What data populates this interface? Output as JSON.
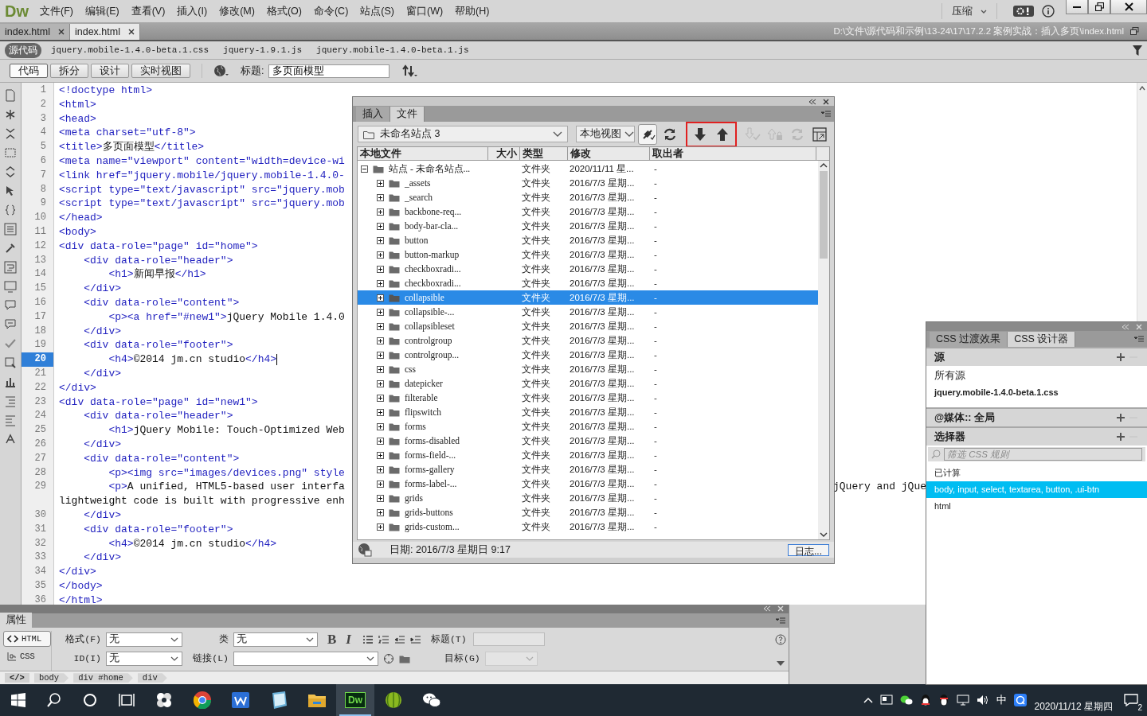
{
  "app": {
    "logo": "Dw",
    "menus": [
      "文件(F)",
      "编辑(E)",
      "查看(V)",
      "插入(I)",
      "修改(M)",
      "格式(O)",
      "命令(C)",
      "站点(S)",
      "窗口(W)",
      "帮助(H)"
    ],
    "workspace": "压缩"
  },
  "doc_tabs": [
    {
      "label": "index.html",
      "selected": false
    },
    {
      "label": "index.html",
      "selected": true
    }
  ],
  "file_path": "D:\\文件\\源代码和示例\\13-24\\17\\17.2.2  案例实战：插入多页\\index.html",
  "related_files": [
    {
      "label": "源代码",
      "selected": true
    },
    {
      "label": "jquery.mobile-1.4.0-beta.1.css",
      "selected": false
    },
    {
      "label": "jquery-1.9.1.js",
      "selected": false
    },
    {
      "label": "jquery.mobile-1.4.0-beta.1.js",
      "selected": false
    }
  ],
  "doc_toolbar": {
    "views": [
      {
        "label": "代码",
        "selected": true
      },
      {
        "label": "拆分",
        "selected": false
      },
      {
        "label": "设计",
        "selected": false
      },
      {
        "label": "实时视图",
        "selected": false
      }
    ],
    "title_label": "标题:",
    "title_value": "多页面模型"
  },
  "code": {
    "lines": [
      {
        "number": "1",
        "parts": [
          "<!doctype html>"
        ],
        "current": false
      },
      {
        "number": "2",
        "parts": [
          "<html>"
        ],
        "current": false
      },
      {
        "number": "3",
        "parts": [
          "<head>"
        ],
        "current": false
      },
      {
        "number": "4",
        "parts": [
          "<meta charset=\"utf-8\">"
        ],
        "current": false
      },
      {
        "number": "5",
        "parts": [
          "<title>",
          "多页面模型",
          "</title>"
        ],
        "current": false
      },
      {
        "number": "6",
        "parts": [
          "<meta name=\"viewport\" content=\"width=device-wi"
        ],
        "current": false
      },
      {
        "number": "7",
        "parts": [
          "<link href=\"jquery.mobile/jquery.mobile-1.4.0-"
        ],
        "current": false
      },
      {
        "number": "8",
        "parts": [
          "<script type=\"text/javascript\" src=\"jquery.mob"
        ],
        "current": false
      },
      {
        "number": "9",
        "parts": [
          "<script type=\"text/javascript\" src=\"jquery.mob"
        ],
        "current": false
      },
      {
        "number": "10",
        "parts": [
          "</head>"
        ],
        "current": false
      },
      {
        "number": "11",
        "parts": [
          "<body>"
        ],
        "current": false
      },
      {
        "number": "12",
        "parts": [
          "<div data-role=\"page\" id=\"home\">"
        ],
        "current": false
      },
      {
        "number": "13",
        "parts": [
          "    <div data-role=\"header\">"
        ],
        "current": false
      },
      {
        "number": "14",
        "parts": [
          "        <h1>",
          "新闻早报",
          "</h1>"
        ],
        "current": false
      },
      {
        "number": "15",
        "parts": [
          "    </div>"
        ],
        "current": false
      },
      {
        "number": "16",
        "parts": [
          "    <div data-role=\"content\">"
        ],
        "current": false
      },
      {
        "number": "17",
        "parts": [
          "        <p><a href=\"#new1\">",
          "jQuery Mobile 1.4.0"
        ],
        "current": false
      },
      {
        "number": "18",
        "parts": [
          "    </div>"
        ],
        "current": false
      },
      {
        "number": "19",
        "parts": [
          "    <div data-role=\"footer\">"
        ],
        "current": false
      },
      {
        "number": "20",
        "parts": [
          "        <h4>",
          "©2014 jm.cn studio",
          "</h4>"
        ],
        "current": true
      },
      {
        "number": "21",
        "parts": [
          "    </div>"
        ],
        "current": false
      },
      {
        "number": "22",
        "parts": [
          "</div>"
        ],
        "current": false
      },
      {
        "number": "23",
        "parts": [
          "<div data-role=\"page\" id=\"new1\">"
        ],
        "current": false
      },
      {
        "number": "24",
        "parts": [
          "    <div data-role=\"header\">"
        ],
        "current": false
      },
      {
        "number": "25",
        "parts": [
          "        <h1>",
          "jQuery Mobile: Touch-Optimized Web"
        ],
        "current": false
      },
      {
        "number": "26",
        "parts": [
          "    </div>"
        ],
        "current": false
      },
      {
        "number": "27",
        "parts": [
          "    <div data-role=\"content\">"
        ],
        "current": false
      },
      {
        "number": "28",
        "parts": [
          "        <p><img src=\"images/devices.png\" style"
        ],
        "current": false
      },
      {
        "number": "29",
        "parts": [
          "        <p>",
          "A unified, HTML5-based user interfa"
        ],
        "tail": "jQuery and jQue",
        "wrap": "lightweight code is built with progressive enh",
        "current": false
      },
      {
        "number": "30",
        "parts": [
          "    </div>"
        ],
        "current": false
      },
      {
        "number": "31",
        "parts": [
          "    <div data-role=\"footer\">"
        ],
        "current": false
      },
      {
        "number": "32",
        "parts": [
          "        <h4>",
          "©2014 jm.cn studio",
          "</h4>"
        ],
        "current": false
      },
      {
        "number": "33",
        "parts": [
          "    </div>"
        ],
        "current": false
      },
      {
        "number": "34",
        "parts": [
          "</div>"
        ],
        "current": false
      },
      {
        "number": "35",
        "parts": [
          "</body>"
        ],
        "current": false
      },
      {
        "number": "36",
        "parts": [
          "</html>"
        ],
        "current": false
      }
    ]
  },
  "files_panel": {
    "tabs": [
      {
        "label": "插入",
        "selected": false
      },
      {
        "label": "文件",
        "selected": true
      }
    ],
    "site": "未命名站点 3",
    "view": "本地视图",
    "tools": [
      {
        "kind": "connect",
        "disabled": false,
        "highlighted": false
      },
      {
        "kind": "refresh",
        "disabled": false,
        "highlighted": false
      },
      {
        "kind": "get",
        "disabled": false,
        "highlighted": true
      },
      {
        "kind": "put",
        "disabled": false,
        "highlighted": true
      },
      {
        "kind": "checkin",
        "disabled": true,
        "highlighted": false
      },
      {
        "kind": "checkout",
        "disabled": true,
        "highlighted": false
      },
      {
        "kind": "sync",
        "disabled": true,
        "highlighted": false
      },
      {
        "kind": "expand",
        "disabled": false,
        "highlighted": false
      }
    ],
    "columns": [
      "本地文件",
      "大小",
      "类型",
      "修改",
      "取出者"
    ],
    "tree": [
      {
        "name": "站点 - 未命名站点...",
        "type": "文件夹",
        "modified": "2020/11/11 星...",
        "checked_out_by": "-",
        "expanded": true,
        "selected": false,
        "children": [
          {
            "name": "_assets",
            "type": "文件夹",
            "modified": "2016/7/3 星期...",
            "checked_out_by": "-",
            "expanded": false,
            "selected": false
          },
          {
            "name": "_search",
            "type": "文件夹",
            "modified": "2016/7/3 星期...",
            "checked_out_by": "-",
            "expanded": false,
            "selected": false
          },
          {
            "name": "backbone-req...",
            "type": "文件夹",
            "modified": "2016/7/3 星期...",
            "checked_out_by": "-",
            "expanded": false,
            "selected": false
          },
          {
            "name": "body-bar-cla...",
            "type": "文件夹",
            "modified": "2016/7/3 星期...",
            "checked_out_by": "-",
            "expanded": false,
            "selected": false
          },
          {
            "name": "button",
            "type": "文件夹",
            "modified": "2016/7/3 星期...",
            "checked_out_by": "-",
            "expanded": false,
            "selected": false
          },
          {
            "name": "button-markup",
            "type": "文件夹",
            "modified": "2016/7/3 星期...",
            "checked_out_by": "-",
            "expanded": false,
            "selected": false
          },
          {
            "name": "checkboxradi...",
            "type": "文件夹",
            "modified": "2016/7/3 星期...",
            "checked_out_by": "-",
            "expanded": false,
            "selected": false
          },
          {
            "name": "checkboxradi...",
            "type": "文件夹",
            "modified": "2016/7/3 星期...",
            "checked_out_by": "-",
            "expanded": false,
            "selected": false
          },
          {
            "name": "collapsible",
            "type": "文件夹",
            "modified": "2016/7/3 星期...",
            "checked_out_by": "-",
            "expanded": false,
            "selected": true
          },
          {
            "name": "collapsible-...",
            "type": "文件夹",
            "modified": "2016/7/3 星期...",
            "checked_out_by": "-",
            "expanded": false,
            "selected": false
          },
          {
            "name": "collapsibleset",
            "type": "文件夹",
            "modified": "2016/7/3 星期...",
            "checked_out_by": "-",
            "expanded": false,
            "selected": false
          },
          {
            "name": "controlgroup",
            "type": "文件夹",
            "modified": "2016/7/3 星期...",
            "checked_out_by": "-",
            "expanded": false,
            "selected": false
          },
          {
            "name": "controlgroup...",
            "type": "文件夹",
            "modified": "2016/7/3 星期...",
            "checked_out_by": "-",
            "expanded": false,
            "selected": false
          },
          {
            "name": "css",
            "type": "文件夹",
            "modified": "2016/7/3 星期...",
            "checked_out_by": "-",
            "expanded": false,
            "selected": false
          },
          {
            "name": "datepicker",
            "type": "文件夹",
            "modified": "2016/7/3 星期...",
            "checked_out_by": "-",
            "expanded": false,
            "selected": false
          },
          {
            "name": "filterable",
            "type": "文件夹",
            "modified": "2016/7/3 星期...",
            "checked_out_by": "-",
            "expanded": false,
            "selected": false
          },
          {
            "name": "flipswitch",
            "type": "文件夹",
            "modified": "2016/7/3 星期...",
            "checked_out_by": "-",
            "expanded": false,
            "selected": false
          },
          {
            "name": "forms",
            "type": "文件夹",
            "modified": "2016/7/3 星期...",
            "checked_out_by": "-",
            "expanded": false,
            "selected": false
          },
          {
            "name": "forms-disabled",
            "type": "文件夹",
            "modified": "2016/7/3 星期...",
            "checked_out_by": "-",
            "expanded": false,
            "selected": false
          },
          {
            "name": "forms-field-...",
            "type": "文件夹",
            "modified": "2016/7/3 星期...",
            "checked_out_by": "-",
            "expanded": false,
            "selected": false
          },
          {
            "name": "forms-gallery",
            "type": "文件夹",
            "modified": "2016/7/3 星期...",
            "checked_out_by": "-",
            "expanded": false,
            "selected": false
          },
          {
            "name": "forms-label-...",
            "type": "文件夹",
            "modified": "2016/7/3 星期...",
            "checked_out_by": "-",
            "expanded": false,
            "selected": false
          },
          {
            "name": "grids",
            "type": "文件夹",
            "modified": "2016/7/3 星期...",
            "checked_out_by": "-",
            "expanded": false,
            "selected": false
          },
          {
            "name": "grids-buttons",
            "type": "文件夹",
            "modified": "2016/7/3 星期...",
            "checked_out_by": "-",
            "expanded": false,
            "selected": false
          },
          {
            "name": "grids-custom...",
            "type": "文件夹",
            "modified": "2016/7/3 星期...",
            "checked_out_by": "-",
            "expanded": false,
            "selected": false
          }
        ]
      }
    ],
    "status": "日期: 2016/7/3 星期日 9:17",
    "log_button": "日志..."
  },
  "css_panel": {
    "tabs": [
      {
        "label": "CSS 过渡效果",
        "selected": false
      },
      {
        "label": "CSS 设计器",
        "selected": true
      }
    ],
    "sections": [
      {
        "title": "源",
        "kind": "list",
        "items": [
          {
            "label": "所有源",
            "selected": false
          },
          {
            "label": "jquery.mobile-1.4.0-beta.1.css",
            "selected": true
          }
        ]
      },
      {
        "title": "@媒体:: 全局",
        "kind": "header"
      },
      {
        "title": "选择器",
        "kind": "list",
        "filter_placeholder": "筛选 CSS 规则",
        "items": [
          {
            "label": "已计算",
            "selected": false
          },
          {
            "label": "body, input, select, textarea, button, .ui-btn",
            "selected": true
          },
          {
            "label": "html",
            "selected": false
          }
        ]
      }
    ]
  },
  "properties": {
    "tab": "属性",
    "modes": [
      {
        "label": "HTML",
        "selected": true
      },
      {
        "label": "CSS",
        "selected": false
      }
    ],
    "format_label": "格式(F)",
    "format_value": "无",
    "id_label": "ID(I)",
    "id_value": "无",
    "class_label": "类",
    "class_value": "无",
    "link_label": "链接(L)",
    "bold": "B",
    "italic": "I",
    "title_label": "标题(T)",
    "target_label": "目标(G)"
  },
  "tag_selector": {
    "toggle": "</>",
    "tags": [
      "body",
      "div #home",
      "div"
    ]
  },
  "taskbar": {
    "apps": [
      {
        "kind": "pinwheel",
        "active": false
      },
      {
        "kind": "ring",
        "active": false
      },
      {
        "kind": "writer",
        "active": false
      },
      {
        "kind": "notebook",
        "active": false
      },
      {
        "kind": "folder",
        "active": false
      },
      {
        "kind": "dw",
        "label": "Dw",
        "active": true
      },
      {
        "kind": "melon",
        "active": false
      },
      {
        "kind": "chat",
        "active": false
      }
    ],
    "ime": "中",
    "date": "2020/11/12 星期四",
    "notifications": "2"
  }
}
